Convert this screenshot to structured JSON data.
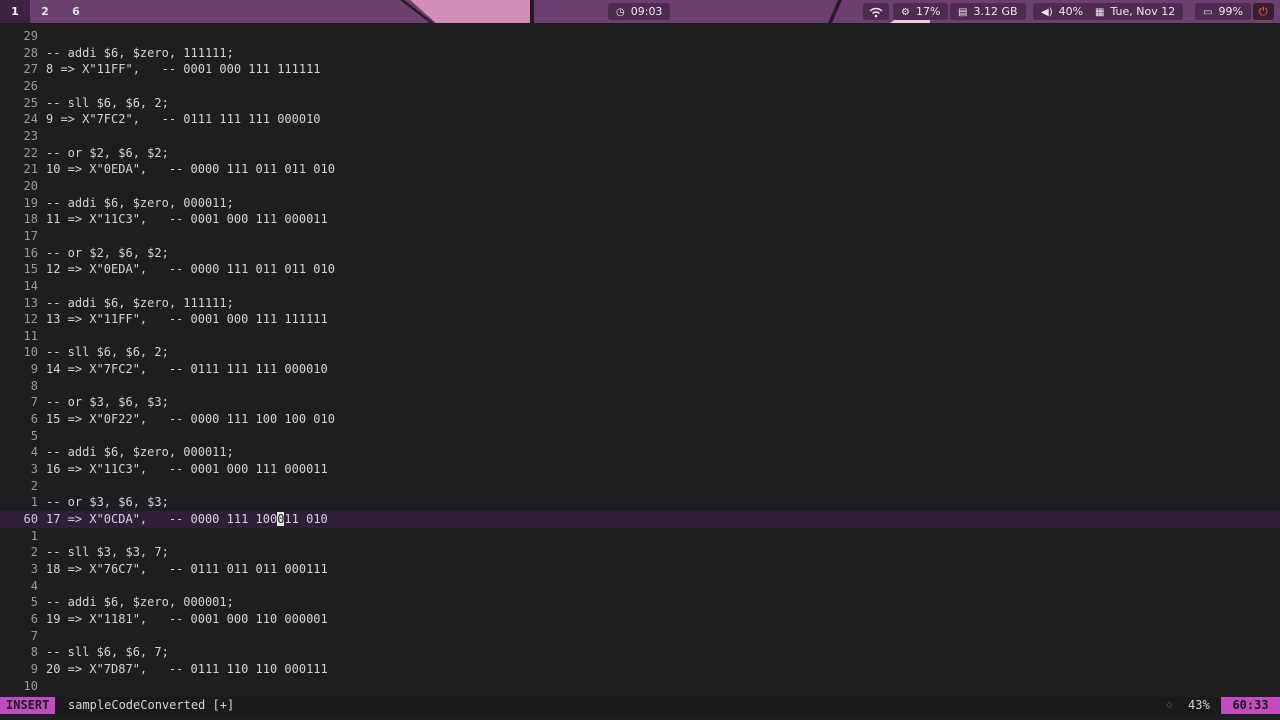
{
  "topbar": {
    "workspaces": [
      "1",
      "2",
      "6"
    ],
    "clock": "09:03",
    "cpu": "17%",
    "memory": "3.12 GB",
    "volume": "40%",
    "date": "Tue, Nov 12",
    "battery": "99%",
    "colors": {
      "bar": "#6b3f6e",
      "pill": "#4d2c50",
      "accent": "#c14cc0"
    }
  },
  "editor": {
    "lines": [
      {
        "num": "29",
        "text": ""
      },
      {
        "num": "28",
        "text": "-- addi $6, $zero, 111111;"
      },
      {
        "num": "27",
        "text": "8 => X\"11FF\",   -- 0001 000 111 111111"
      },
      {
        "num": "26",
        "text": ""
      },
      {
        "num": "25",
        "text": "-- sll $6, $6, 2;"
      },
      {
        "num": "24",
        "text": "9 => X\"7FC2\",   -- 0111 111 111 000010"
      },
      {
        "num": "23",
        "text": ""
      },
      {
        "num": "22",
        "text": "-- or $2, $6, $2;"
      },
      {
        "num": "21",
        "text": "10 => X\"0EDA\",   -- 0000 111 011 011 010"
      },
      {
        "num": "20",
        "text": ""
      },
      {
        "num": "19",
        "text": "-- addi $6, $zero, 000011;"
      },
      {
        "num": "18",
        "text": "11 => X\"11C3\",   -- 0001 000 111 000011"
      },
      {
        "num": "17",
        "text": ""
      },
      {
        "num": "16",
        "text": "-- or $2, $6, $2;"
      },
      {
        "num": "15",
        "text": "12 => X\"0EDA\",   -- 0000 111 011 011 010"
      },
      {
        "num": "14",
        "text": ""
      },
      {
        "num": "13",
        "text": "-- addi $6, $zero, 111111;"
      },
      {
        "num": "12",
        "text": "13 => X\"11FF\",   -- 0001 000 111 111111"
      },
      {
        "num": "11",
        "text": ""
      },
      {
        "num": "10",
        "text": "-- sll $6, $6, 2;"
      },
      {
        "num": "9",
        "text": "14 => X\"7FC2\",   -- 0111 111 111 000010"
      },
      {
        "num": "8",
        "text": ""
      },
      {
        "num": "7",
        "text": "-- or $3, $6, $3;"
      },
      {
        "num": "6",
        "text": "15 => X\"0F22\",   -- 0000 111 100 100 010"
      },
      {
        "num": "5",
        "text": ""
      },
      {
        "num": "4",
        "text": "-- addi $6, $zero, 000011;"
      },
      {
        "num": "3",
        "text": "16 => X\"11C3\",   -- 0001 000 111 000011"
      },
      {
        "num": "2",
        "text": ""
      },
      {
        "num": "1",
        "text": "-- or $3, $6, $3;"
      },
      {
        "num": "60",
        "text": "17 => X\"0CDA\",   -- 0000 111 100011 010",
        "cursor": true,
        "before": "17 => X\"0CDA\",   -- 0000 111 100",
        "at": "0",
        "after": "11 010"
      },
      {
        "num": "1",
        "text": ""
      },
      {
        "num": "2",
        "text": "-- sll $3, $3, 7;"
      },
      {
        "num": "3",
        "text": "18 => X\"76C7\",   -- 0111 011 011 000111"
      },
      {
        "num": "4",
        "text": ""
      },
      {
        "num": "5",
        "text": "-- addi $6, $zero, 000001;"
      },
      {
        "num": "6",
        "text": "19 => X\"1181\",   -- 0001 000 110 000001"
      },
      {
        "num": "7",
        "text": ""
      },
      {
        "num": "8",
        "text": "-- sll $6, $6, 7;"
      },
      {
        "num": "9",
        "text": "20 => X\"7D87\",   -- 0111 110 110 000111"
      },
      {
        "num": "10",
        "text": ""
      }
    ]
  },
  "statusline": {
    "mode": "INSERT",
    "filename": "sampleCodeConverted [+]",
    "percent": "43%",
    "position": "60:33"
  }
}
